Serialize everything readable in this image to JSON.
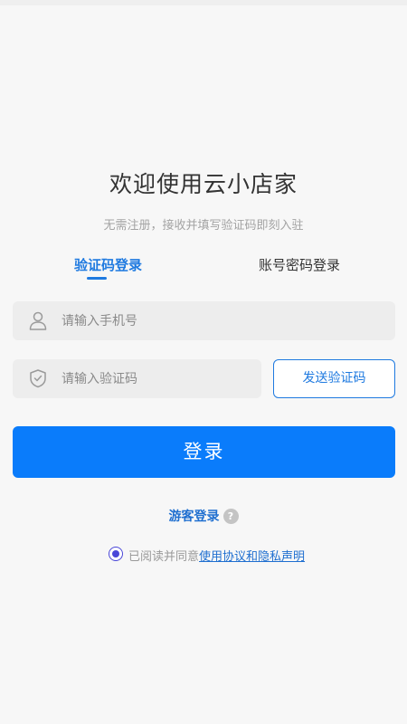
{
  "header": {
    "title": "欢迎使用云小店家",
    "subtitle": "无需注册，接收并填写验证码即刻入驻"
  },
  "tabs": [
    {
      "label": "验证码登录",
      "active": true
    },
    {
      "label": "账号密码登录",
      "active": false
    }
  ],
  "form": {
    "phone": {
      "placeholder": "请输入手机号",
      "value": "",
      "icon": "user-icon"
    },
    "code": {
      "placeholder": "请输入验证码",
      "value": "",
      "icon": "shield-icon"
    },
    "send_code_label": "发送验证码",
    "submit_label": "登录"
  },
  "guest": {
    "label": "游客登录",
    "help_symbol": "?"
  },
  "agreement": {
    "checked": true,
    "prefix": "已阅读并同意",
    "link_label": "使用协议和隐私声明"
  },
  "colors": {
    "accent": "#1f7ae0",
    "button": "#0a7cfb",
    "radio": "#4a47d8",
    "background": "#f7f7f7"
  }
}
